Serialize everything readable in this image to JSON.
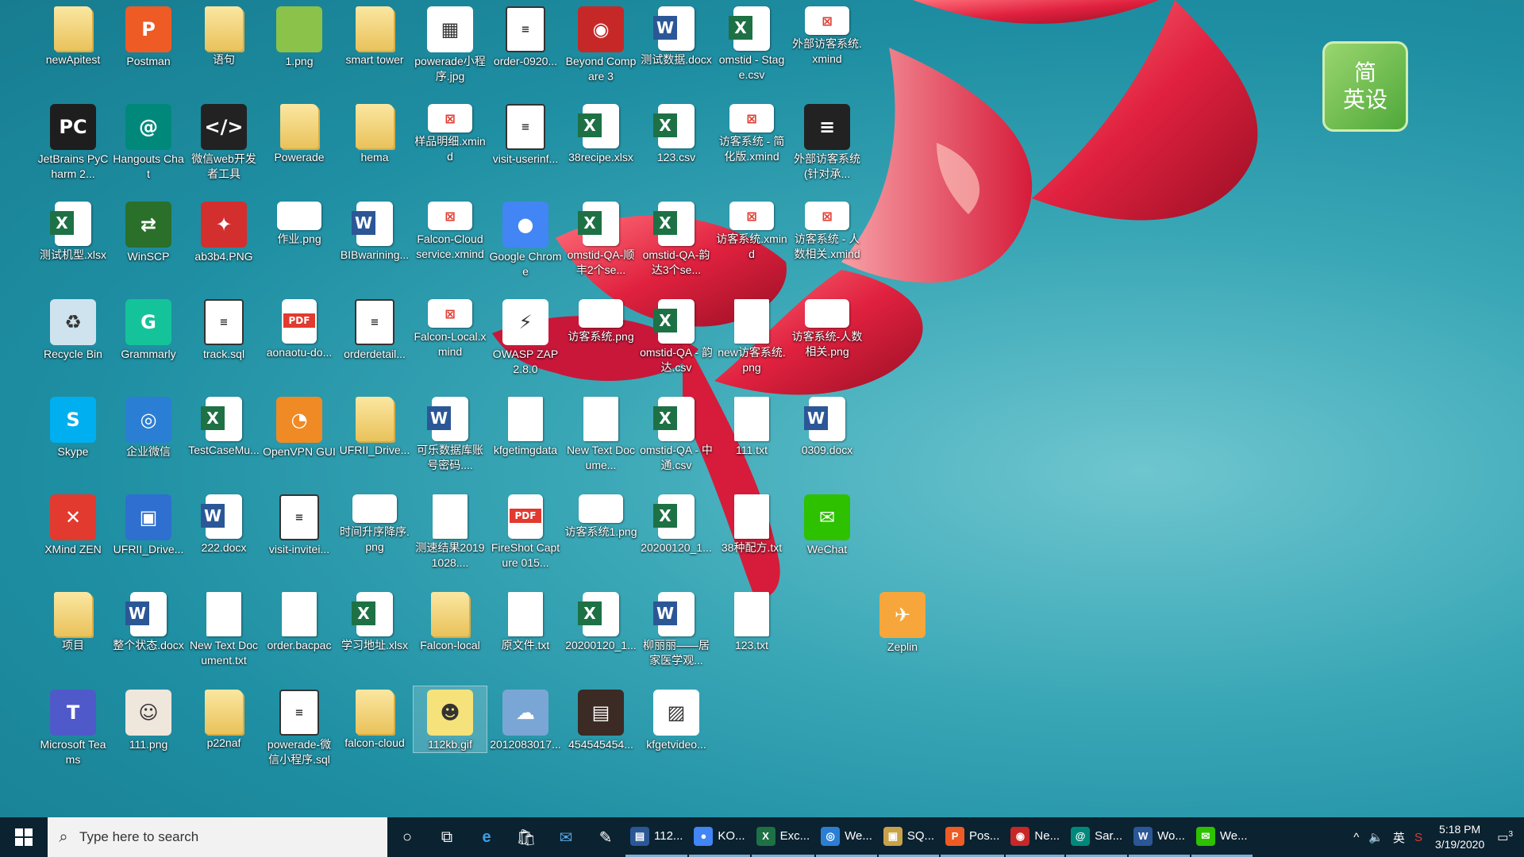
{
  "desktop": {
    "icons": [
      {
        "label": "newApitest",
        "kind": "folder"
      },
      {
        "label": "Postman",
        "kind": "app",
        "color": "#ef5b25",
        "glyph": "P"
      },
      {
        "label": "语句",
        "kind": "folder"
      },
      {
        "label": "1.png",
        "kind": "app",
        "color": "#8bc34a",
        "glyph": ""
      },
      {
        "label": "smart tower",
        "kind": "folder"
      },
      {
        "label": "powerade小程序.jpg",
        "kind": "app",
        "color": "#ffffff",
        "glyph": "▦"
      },
      {
        "label": "order-0920...",
        "kind": "sql"
      },
      {
        "label": "Beyond Compare 3",
        "kind": "app",
        "color": "#c62828",
        "glyph": "◉"
      },
      {
        "label": "测试数据.docx",
        "kind": "word"
      },
      {
        "label": "omstid - Stage.csv",
        "kind": "excel"
      },
      {
        "label": "外部访客系统.xmind",
        "kind": "xmind"
      },
      {
        "label": "JetBrains PyCharm 2...",
        "kind": "app",
        "color": "#1e1e1e",
        "glyph": "PC"
      },
      {
        "label": "Hangouts Chat",
        "kind": "app",
        "color": "#00897b",
        "glyph": "@"
      },
      {
        "label": "微信web开发者工具",
        "kind": "app",
        "color": "#222222",
        "glyph": "</>"
      },
      {
        "label": "Powerade",
        "kind": "folder"
      },
      {
        "label": "hema",
        "kind": "folder"
      },
      {
        "label": "样品明细.xmind",
        "kind": "xmind"
      },
      {
        "label": "visit-userinf...",
        "kind": "sql"
      },
      {
        "label": "38recipe.xlsx",
        "kind": "excel"
      },
      {
        "label": "123.csv",
        "kind": "excel"
      },
      {
        "label": "访客系统 - 简化版.xmind",
        "kind": "xmind"
      },
      {
        "label": "外部访客系统(针对承...",
        "kind": "app",
        "color": "#222222",
        "glyph": "≡"
      },
      {
        "label": "测试机型.xlsx",
        "kind": "excel"
      },
      {
        "label": "WinSCP",
        "kind": "app",
        "color": "#2a6f2a",
        "glyph": "⇄"
      },
      {
        "label": "ab3b4.PNG",
        "kind": "app",
        "color": "#d32f2f",
        "glyph": "✦"
      },
      {
        "label": "作业.png",
        "kind": "img"
      },
      {
        "label": "BIBwarining...",
        "kind": "word"
      },
      {
        "label": "Falcon-Cloud service.xmind",
        "kind": "xmind"
      },
      {
        "label": "Google Chrome",
        "kind": "app",
        "color": "#4285f4",
        "glyph": "●"
      },
      {
        "label": "omstid-QA-顺丰2个se...",
        "kind": "excel"
      },
      {
        "label": "omstid-QA-韵达3个se...",
        "kind": "excel"
      },
      {
        "label": "访客系统.xmind",
        "kind": "xmind"
      },
      {
        "label": "访客系统 - 人数相关.xmind",
        "kind": "xmind"
      },
      {
        "label": "Recycle Bin",
        "kind": "app",
        "color": "#cfe3ef",
        "glyph": "♻"
      },
      {
        "label": "Grammarly",
        "kind": "app",
        "color": "#15c39a",
        "glyph": "G"
      },
      {
        "label": "track.sql",
        "kind": "sql"
      },
      {
        "label": "aonaotu-do...",
        "kind": "pdf"
      },
      {
        "label": "orderdetail...",
        "kind": "sql"
      },
      {
        "label": "Falcon-Local.xmind",
        "kind": "xmind"
      },
      {
        "label": "OWASP ZAP 2.8.0",
        "kind": "app",
        "color": "#ffffff",
        "glyph": "⚡"
      },
      {
        "label": "访客系统.png",
        "kind": "img"
      },
      {
        "label": "omstid-QA - 韵达.csv",
        "kind": "excel"
      },
      {
        "label": "new访客系统.png",
        "kind": "doc"
      },
      {
        "label": "访客系统-人数相关.png",
        "kind": "img"
      },
      {
        "label": "Skype",
        "kind": "app",
        "color": "#00aff0",
        "glyph": "S"
      },
      {
        "label": "企业微信",
        "kind": "app",
        "color": "#2a7fd4",
        "glyph": "◎"
      },
      {
        "label": "TestCaseMu...",
        "kind": "excel"
      },
      {
        "label": "OpenVPN GUI",
        "kind": "app",
        "color": "#f08a24",
        "glyph": "◔"
      },
      {
        "label": "UFRII_Drive...",
        "kind": "folder"
      },
      {
        "label": "可乐数据库账号密码....",
        "kind": "word"
      },
      {
        "label": "kfgetimgdata",
        "kind": "doc"
      },
      {
        "label": "New Text Docume...",
        "kind": "doc"
      },
      {
        "label": "omstid-QA - 中通.csv",
        "kind": "excel"
      },
      {
        "label": "111.txt",
        "kind": "doc"
      },
      {
        "label": "0309.docx",
        "kind": "word"
      },
      {
        "label": "XMind ZEN",
        "kind": "app",
        "color": "#e23a2e",
        "glyph": "✕"
      },
      {
        "label": "UFRII_Drive...",
        "kind": "app",
        "color": "#2f6fd0",
        "glyph": "▣"
      },
      {
        "label": "222.docx",
        "kind": "word"
      },
      {
        "label": "visit-invitei...",
        "kind": "sql"
      },
      {
        "label": "时间升序降序.png",
        "kind": "img"
      },
      {
        "label": "测速结果20191028....",
        "kind": "doc"
      },
      {
        "label": "FireShot Capture 015...",
        "kind": "pdf"
      },
      {
        "label": "访客系统1.png",
        "kind": "img"
      },
      {
        "label": "20200120_1...",
        "kind": "excel"
      },
      {
        "label": "38种配方.txt",
        "kind": "doc"
      },
      {
        "label": "WeChat",
        "kind": "app",
        "color": "#2dc100",
        "glyph": "✉"
      },
      {
        "label": "项目",
        "kind": "folder"
      },
      {
        "label": "整个状态.docx",
        "kind": "word"
      },
      {
        "label": "New Text Document.txt",
        "kind": "doc"
      },
      {
        "label": "order.bacpac",
        "kind": "doc"
      },
      {
        "label": "学习地址.xlsx",
        "kind": "excel"
      },
      {
        "label": "Falcon-local",
        "kind": "folder"
      },
      {
        "label": "原文件.txt",
        "kind": "doc"
      },
      {
        "label": "20200120_1...",
        "kind": "excel"
      },
      {
        "label": "柳丽丽——居家医学观...",
        "kind": "word"
      },
      {
        "label": "123.txt",
        "kind": "doc"
      },
      {
        "label": "Zeplin",
        "kind": "app",
        "color": "#f6a63a",
        "glyph": "✈"
      },
      {
        "label": "Microsoft Teams",
        "kind": "app",
        "color": "#5059c9",
        "glyph": "T"
      },
      {
        "label": "111.png",
        "kind": "app",
        "color": "#efe6dc",
        "glyph": "☺"
      },
      {
        "label": "p22naf",
        "kind": "folder"
      },
      {
        "label": "powerade-微信小程序.sql",
        "kind": "sql"
      },
      {
        "label": "falcon-cloud",
        "kind": "folder"
      },
      {
        "label": "112kb.gif",
        "kind": "app",
        "color": "#f6e27a",
        "glyph": "☻"
      },
      {
        "label": "2012083017...",
        "kind": "app",
        "color": "#7aa6d6",
        "glyph": "☁"
      },
      {
        "label": "454545454...",
        "kind": "app",
        "color": "#3b2b24",
        "glyph": "▤"
      },
      {
        "label": "kfgetvideo...",
        "kind": "app",
        "color": "#ffffff",
        "glyph": "▨"
      }
    ],
    "logo": {
      "line1": "简",
      "line2": "英设"
    }
  },
  "taskbar": {
    "search_placeholder": "Type here to search",
    "apps": [
      {
        "label": "112...",
        "color": "#2b5797",
        "glyph": "▤"
      },
      {
        "label": "KO...",
        "color": "#4285f4",
        "glyph": "●"
      },
      {
        "label": "Exc...",
        "color": "#1e7145",
        "glyph": "X"
      },
      {
        "label": "We...",
        "color": "#2a7fd4",
        "glyph": "◎"
      },
      {
        "label": "SQ...",
        "color": "#c8a24a",
        "glyph": "▣"
      },
      {
        "label": "Pos...",
        "color": "#ef5b25",
        "glyph": "P"
      },
      {
        "label": "Ne...",
        "color": "#c62828",
        "glyph": "◉"
      },
      {
        "label": "Sar...",
        "color": "#00897b",
        "glyph": "@"
      },
      {
        "label": "Wo...",
        "color": "#2b5797",
        "glyph": "W"
      },
      {
        "label": "We...",
        "color": "#2dc100",
        "glyph": "✉"
      }
    ],
    "ime": "英",
    "time": "5:18 PM",
    "date": "3/19/2020",
    "notification_count": "3"
  }
}
